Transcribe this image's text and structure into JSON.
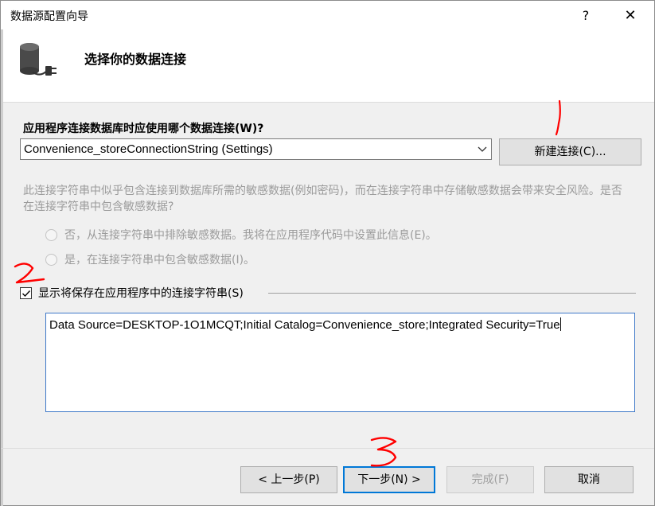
{
  "window": {
    "title": "数据源配置向导",
    "help_label": "?",
    "close_label": "✕"
  },
  "header": {
    "title": "选择你的数据连接"
  },
  "connection": {
    "question": "应用程序连接数据库时应使用哪个数据连接(W)?",
    "selected_value": "Convenience_storeConnectionString (Settings)",
    "new_button_label": "新建连接(C)..."
  },
  "sensitive": {
    "warning": "此连接字符串中似乎包含连接到数据库所需的敏感数据(例如密码)，而在连接字符串中存储敏感数据会带来安全风险。是否在连接字符串中包含敏感数据?",
    "option_exclude": "否，从连接字符串中排除敏感数据。我将在应用程序代码中设置此信息(E)。",
    "option_include": "是，在连接字符串中包含敏感数据(I)。"
  },
  "show_string": {
    "label": "显示将保存在应用程序中的连接字符串(S)",
    "checked": true,
    "value": "Data Source=DESKTOP-1O1MCQT;Initial Catalog=Convenience_store;Integrated Security=True"
  },
  "footer": {
    "prev_label": "< 上一步(P)",
    "next_label": "下一步(N) >",
    "finish_label": "完成(F)",
    "cancel_label": "取消"
  },
  "annotations": {
    "color": "#ff0000",
    "marks": [
      "1",
      "2",
      "3"
    ]
  },
  "icons": {
    "header": "database-plug-icon",
    "dropdown": "chevron-down-icon",
    "checkbox": "checkmark-icon"
  }
}
